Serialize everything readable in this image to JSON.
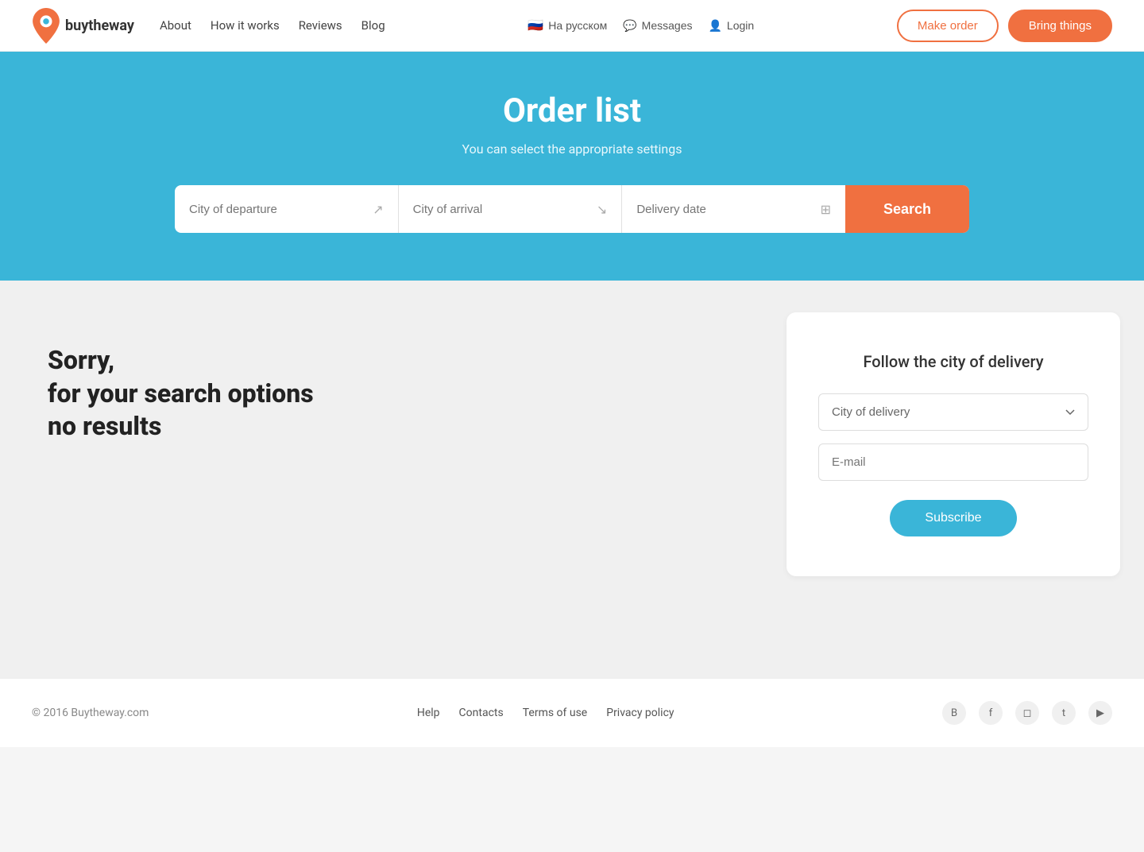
{
  "header": {
    "logo_text": "buytheway",
    "nav": [
      {
        "label": "About",
        "href": "#"
      },
      {
        "label": "How it works",
        "href": "#"
      },
      {
        "label": "Reviews",
        "href": "#"
      },
      {
        "label": "Blog",
        "href": "#"
      }
    ],
    "lang_label": "На русском",
    "messages_label": "Messages",
    "login_label": "Login",
    "make_order_label": "Make order",
    "bring_things_label": "Bring things"
  },
  "hero": {
    "title": "Order list",
    "subtitle": "You can select the appropriate settings",
    "search": {
      "departure_placeholder": "City of departure",
      "arrival_placeholder": "City of arrival",
      "date_placeholder": "Delivery date",
      "button_label": "Search"
    }
  },
  "no_results": {
    "line1": "Sorry,",
    "line2": "for your search options",
    "line3": "no results"
  },
  "subscribe": {
    "title": "Follow the city of delivery",
    "city_placeholder": "City of delivery",
    "email_placeholder": "E-mail",
    "button_label": "Subscribe"
  },
  "footer": {
    "copyright": "© 2016 Buytheway.com",
    "links": [
      {
        "label": "Help",
        "href": "#"
      },
      {
        "label": "Contacts",
        "href": "#"
      },
      {
        "label": "Terms of use",
        "href": "#"
      },
      {
        "label": "Privacy policy",
        "href": "#"
      }
    ],
    "social": [
      {
        "name": "vk",
        "icon": "В"
      },
      {
        "name": "facebook",
        "icon": "f"
      },
      {
        "name": "instagram",
        "icon": "◻"
      },
      {
        "name": "twitter",
        "icon": "t"
      },
      {
        "name": "youtube",
        "icon": "▶"
      }
    ]
  }
}
